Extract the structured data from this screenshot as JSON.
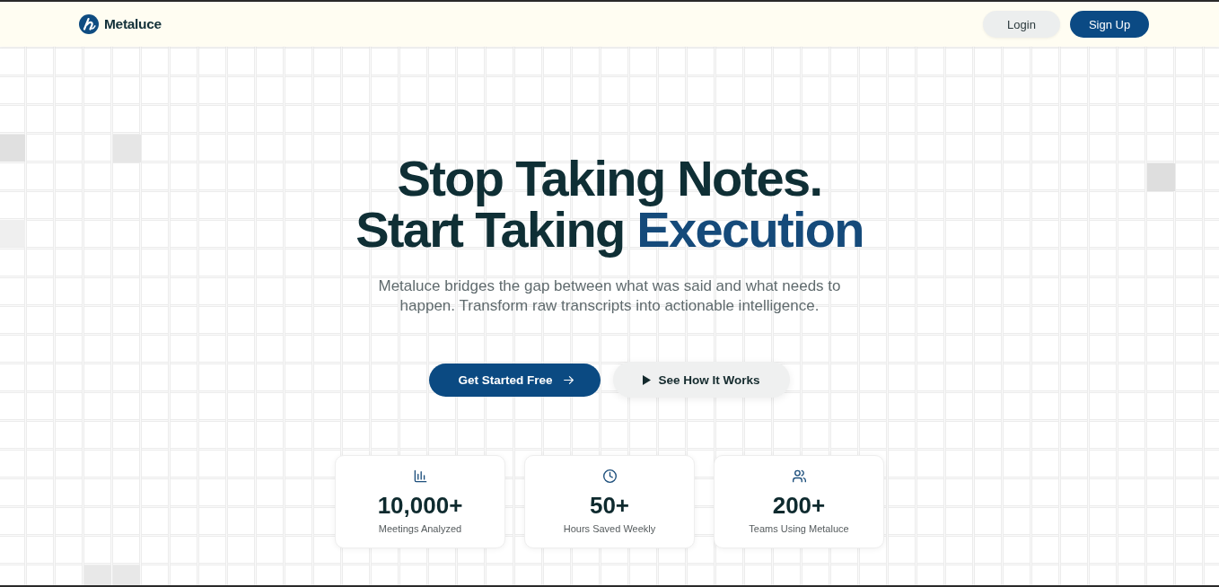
{
  "header": {
    "logo": {
      "text": "Metaluce"
    },
    "buttons": [
      {
        "label": "Login",
        "kind": "secondary"
      },
      {
        "label": "Sign Up",
        "kind": "primary"
      }
    ]
  },
  "hero": {
    "headline": {
      "lines": [
        {
          "segments": [
            {
              "text": "Stop Taking Notes.",
              "accent": false
            }
          ]
        },
        {
          "segments": [
            {
              "text": "Start Taking",
              "accent": false
            },
            {
              "text": "Execution",
              "accent": true
            }
          ]
        }
      ]
    },
    "subtitle": "Metaluce bridges the gap between what was said and what needs to happen. Transform raw transcripts into actionable intelligence.",
    "actions": [
      {
        "label": "Get Started Free",
        "kind": "primary"
      },
      {
        "label": "See How It Works",
        "kind": "secondary"
      }
    ]
  },
  "stats": [
    {
      "value": "10,000+",
      "label": "Meetings Analyzed"
    },
    {
      "value": "50+",
      "label": "Hours Saved Weekly"
    },
    {
      "value": "200+",
      "label": "Teams Using Metaluce"
    }
  ]
}
